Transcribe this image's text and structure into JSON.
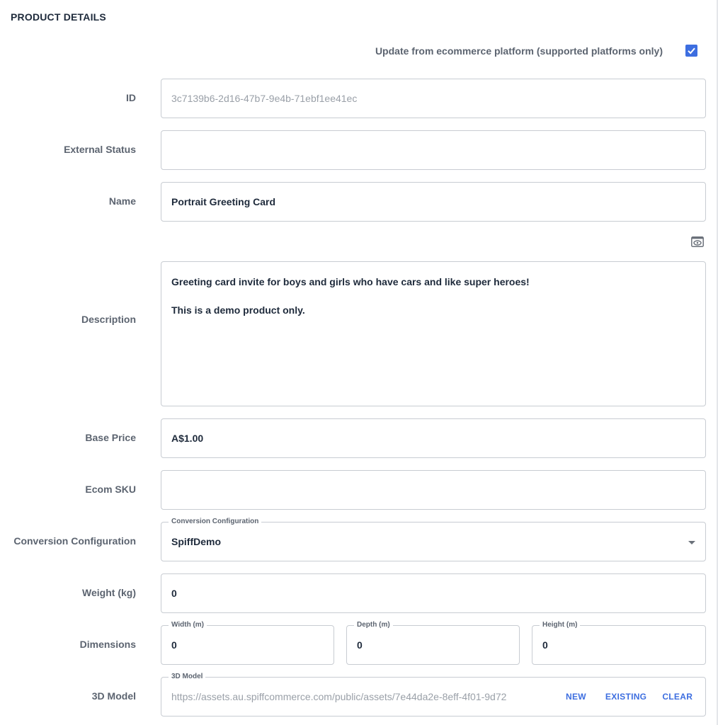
{
  "section": {
    "title": "PRODUCT DETAILS"
  },
  "sync": {
    "label": "Update from ecommerce platform (supported platforms only)",
    "checked": true
  },
  "id_field": {
    "label": "ID",
    "value": "3c7139b6-2d16-47b7-9e4b-71ebf1ee41ec"
  },
  "external_status": {
    "label": "External Status",
    "value": ""
  },
  "name": {
    "label": "Name",
    "value": "Portrait Greeting Card"
  },
  "description": {
    "label": "Description",
    "line1": "Greeting card invite for boys and girls who have cars and like super heroes!",
    "line2": "",
    "line3": "This is a demo product only."
  },
  "base_price": {
    "label": "Base Price",
    "value": "A$1.00"
  },
  "ecom_sku": {
    "label": "Ecom SKU",
    "value": ""
  },
  "conversion": {
    "label": "Conversion Configuration",
    "legend": "Conversion Configuration",
    "value": "SpiffDemo"
  },
  "weight": {
    "label": "Weight (kg)",
    "value": "0"
  },
  "dimensions": {
    "label": "Dimensions",
    "width": {
      "legend": "Width (m)",
      "value": "0"
    },
    "depth": {
      "legend": "Depth (m)",
      "value": "0"
    },
    "height": {
      "legend": "Height (m)",
      "value": "0"
    }
  },
  "model3d": {
    "label": "3D Model",
    "legend": "3D Model",
    "value": "https://assets.au.spiffcommerce.com/public/assets/7e44da2e-8eff-4f01-9d72",
    "new_label": "NEW",
    "existing_label": "EXISTING",
    "clear_label": "CLEAR"
  },
  "colors": {
    "accent": "#3d6ee0",
    "text": "#1e2a3b",
    "label": "#5c6470",
    "border": "#c8ccd2"
  }
}
